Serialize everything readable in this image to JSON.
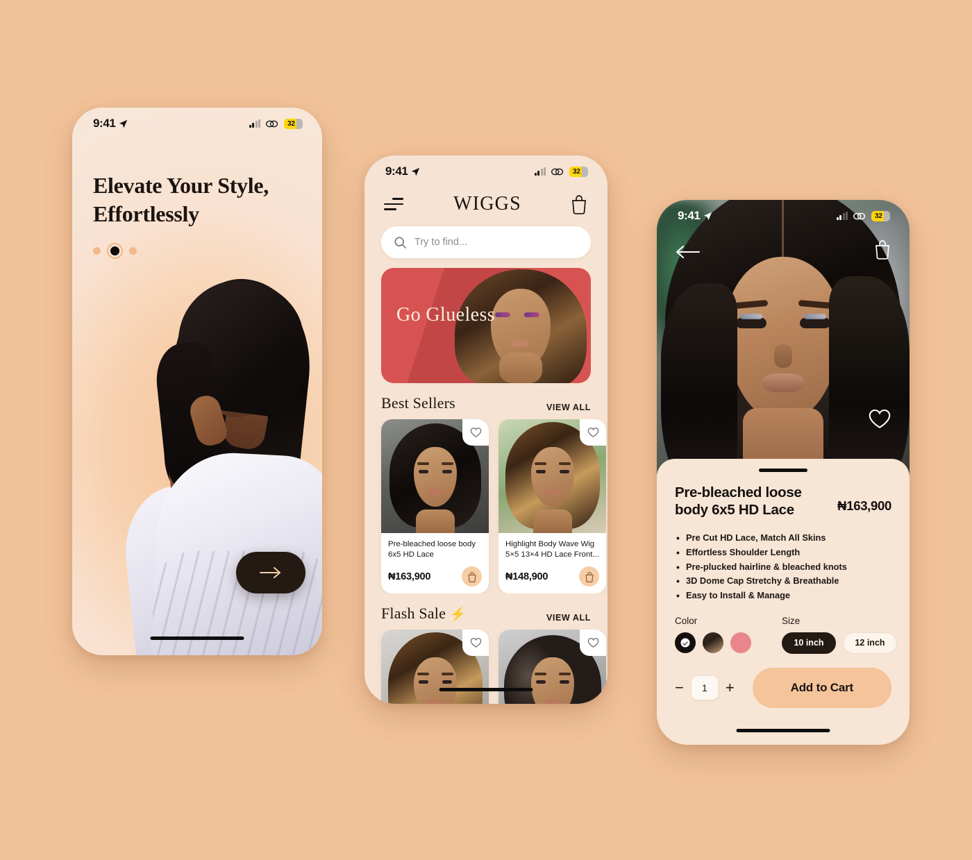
{
  "theme": {
    "page_background": "#f2c29a",
    "screen_background": "#f6e3d3",
    "accent_peach": "#f6c49a",
    "dark": "#241a14",
    "promo_red": "#d75352"
  },
  "status_bar": {
    "time": "9:41",
    "battery_level": "32",
    "location_icon": "location-arrow-icon",
    "signal_icon": "cellular-signal-icon",
    "link_icon": "link-chain-icon",
    "battery_icon": "battery-icon"
  },
  "screen_onboarding": {
    "title": "Elevate Your Style,\nEffortlessly",
    "title_line1": "Elevate Your Style,",
    "title_line2": "Effortlessly",
    "pagination": {
      "total": 3,
      "active_index": 1
    },
    "next_button_icon": "arrow-right-icon",
    "next_button_label": ""
  },
  "screen_home": {
    "nav": {
      "menu_icon": "hamburger-menu-icon",
      "brand": "WIGGS",
      "bag_icon": "shopping-bag-icon"
    },
    "search": {
      "placeholder": "Try to find...",
      "value": "",
      "icon": "search-icon"
    },
    "promo": {
      "title": "Go Glueless",
      "background_color": "#d75352"
    },
    "sections": [
      {
        "title": "Best Sellers",
        "emoji": "",
        "view_all_label": "VIEW ALL",
        "products": [
          {
            "name": "Pre-bleached loose body 6x5 HD Lace",
            "price": "₦163,900",
            "thumb": "th-a",
            "hair": "hair-dark",
            "fav_icon": "heart-outline-icon",
            "cart_icon": "shopping-bag-icon"
          },
          {
            "name": "Highlight Body Wave Wig 5×5 13×4 HD Lace Front...",
            "price": "₦148,900",
            "thumb": "th-b",
            "hair": "hair-blonde",
            "fav_icon": "heart-outline-icon",
            "cart_icon": "shopping-bag-icon"
          },
          {
            "name": "",
            "price": "",
            "thumb": "th-c",
            "hair": "hair-curl",
            "fav_icon": "heart-outline-icon",
            "cart_icon": "shopping-bag-icon"
          }
        ]
      },
      {
        "title": "Flash Sale",
        "emoji": "⚡",
        "view_all_label": "VIEW ALL",
        "products": [
          {
            "name": "",
            "price": "",
            "thumb": "th-d",
            "hair": "hair-blonde",
            "fav_icon": "heart-outline-icon",
            "cart_icon": "shopping-bag-icon"
          },
          {
            "name": "",
            "price": "",
            "thumb": "th-e",
            "hair": "hair-curl",
            "fav_icon": "heart-outline-icon",
            "cart_icon": "shopping-bag-icon"
          }
        ]
      }
    ]
  },
  "screen_detail": {
    "back_icon": "arrow-left-icon",
    "bag_icon": "shopping-bag-icon",
    "favorite_icon": "heart-outline-icon",
    "title": "Pre-bleached loose body 6x5 HD Lace",
    "price": "₦163,900",
    "features": [
      "Pre Cut HD Lace, Match All Skins",
      "Effortless Shoulder Length",
      "Pre-plucked hairline & bleached knots",
      "3D Dome Cap Stretchy & Breathable",
      "Easy to Install & Manage"
    ],
    "color": {
      "label": "Color",
      "options": [
        {
          "name": "black",
          "hex": "#140f0d",
          "selected": true
        },
        {
          "name": "brown-ombre",
          "hex": "#3b2c22",
          "selected": false
        },
        {
          "name": "pink",
          "hex": "#e8868c",
          "selected": false
        }
      ]
    },
    "size": {
      "label": "Size",
      "options": [
        {
          "label": "10 inch",
          "selected": true
        },
        {
          "label": "12 inch",
          "selected": false
        }
      ]
    },
    "quantity": {
      "decrement_label": "−",
      "value": "1",
      "increment_label": "+"
    },
    "add_to_cart_label": "Add to Cart"
  }
}
